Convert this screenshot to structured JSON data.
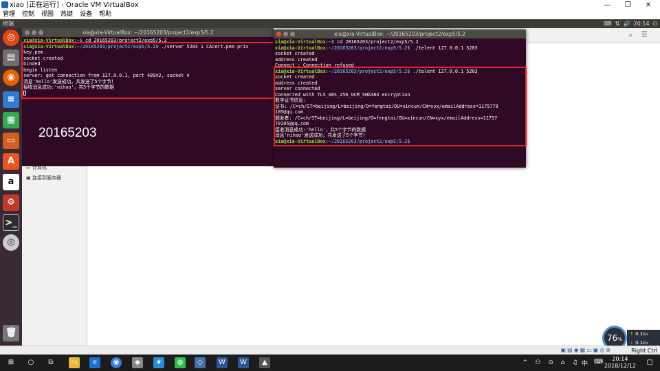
{
  "vbox": {
    "title": "xiao [正在运行] - Oracle VM VirtualBox",
    "menu": [
      "管理",
      "控制",
      "视图",
      "热键",
      "设备",
      "帮助"
    ],
    "right_ctrl": "Right Ctrl"
  },
  "ubuntu": {
    "app_title": "终端",
    "clock": "20:14"
  },
  "files": {
    "side_items": [
      "计算机",
      "连接到服务器"
    ]
  },
  "term1": {
    "title": "xia@xia-VirtualBox: ~/20165203/project2/exp5/5.2",
    "lines": [
      {
        "user": "xia@xia-VirtualBox",
        "path": ":~$",
        "cmd": " cd 20165203/project2/exp5/5.2"
      },
      {
        "user": "xia@xia-VirtualBox",
        "path": ":~/20165203/project2/exp5/5.2$",
        "cmd": " ./server 5203 1 CAcert.pem priv"
      }
    ],
    "output": [
      "key.pem",
      "socket created",
      "binded",
      "begin listen",
      "server: got connection from 127.0.0.1, port 48942, socket 4",
      "消息'hello'发送成功，共发送了5个字节！",
      "接收消息成功:'nihao'，共5个字节的数据"
    ],
    "overlay": "20165203"
  },
  "term2": {
    "title": "xia@xia-VirtualBox: ~/20165203/project2/exp5/5.2",
    "p1": {
      "user": "xia@xia-VirtualBox",
      "path": ":~$",
      "cmd": " cd 20165203/project2/exp5/5.2"
    },
    "p2": {
      "user": "xia@xia-VirtualBox",
      "path": ":~/20165203/project2/exp5/5.2$",
      "cmd": " ./telent 127.0.0.1 5203"
    },
    "out1": [
      "socket created",
      "address created",
      "Connect : Connection refused"
    ],
    "p3": {
      "user": "xia@xia-VirtualBox",
      "path": ":~/20165203/project2/exp5/5.2$",
      "cmd": " ./telent 127.0.0.1 5203"
    },
    "out2": [
      "socket created",
      "address created",
      "server connected",
      "Connected with TLS_AES_256_GCM_SHA384 encryption",
      "数字证书信息:",
      "证书: /C=ch/ST=beijing/L=beijing/O=fengtai/OU=xincun/CN=xyx/emailAddress=1175779",
      "105@qq.com",
      "颁发者: /C=ch/ST=beijing/L=beijing/O=fengtai/OU=xincun/CN=xyx/emailAddress=11757",
      "79105@qq.com",
      "接收消息成功:'hello'，共5个字节的数据",
      "消息'nihao'发送成功，共发送了5个字节！"
    ],
    "p4": {
      "user": "xia@xia-VirtualBox",
      "path": ":~/20165203/project2/exp5/5.2$",
      "cmd": ""
    }
  },
  "net": {
    "percent": "76",
    "unit": "%",
    "up": "0.1",
    "down": "0.1",
    "rate_unit": "K/s"
  },
  "taskbar": {
    "time": "20:14",
    "date": "2018/12/12",
    "ime": "中"
  },
  "colors": {
    "terminal_bg": "#300a24",
    "prompt_user": "#8ae234",
    "prompt_path": "#729fcf",
    "highlight": "#e8232d"
  }
}
